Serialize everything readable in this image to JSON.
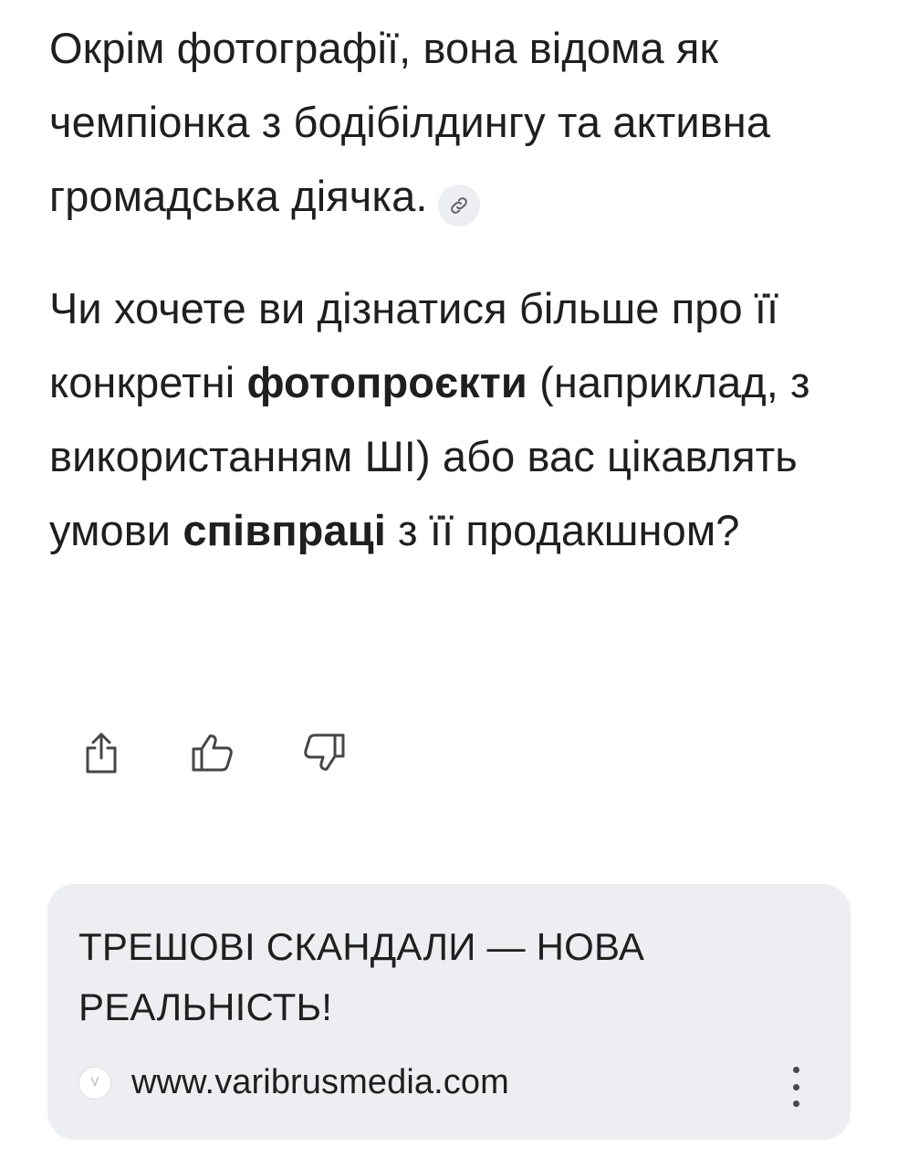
{
  "answer": {
    "para1": "Окрім фотографії, вона відома як чемпіонка з бодібілдингу та активна громадська діячка.",
    "para2": {
      "part1": "Чи хочете ви дізнатися більше про її конкретні ",
      "bold1": "фотопроєкти",
      "part2": " (наприклад, з використанням ШІ) або вас цікавлять умови ",
      "bold2": "співпраці",
      "part3": " з її продакшном?"
    },
    "source_chip_icon": "link-icon"
  },
  "actions": [
    {
      "icon": "share-icon"
    },
    {
      "icon": "thumbs-up-icon"
    },
    {
      "icon": "thumbs-down-icon"
    }
  ],
  "ad_card": {
    "title": "ТРЕШОВІ СКАНДАЛИ — НОВА РЕАЛЬНІСТЬ!",
    "favicon_letter": "V",
    "domain": "www.varibrusmedia.com",
    "menu_icon": "more-vert-icon"
  },
  "colors": {
    "text": "#1f1f1f",
    "card_bg": "#eceef2",
    "chip_bg": "#eceef1",
    "icon": "#444746"
  }
}
